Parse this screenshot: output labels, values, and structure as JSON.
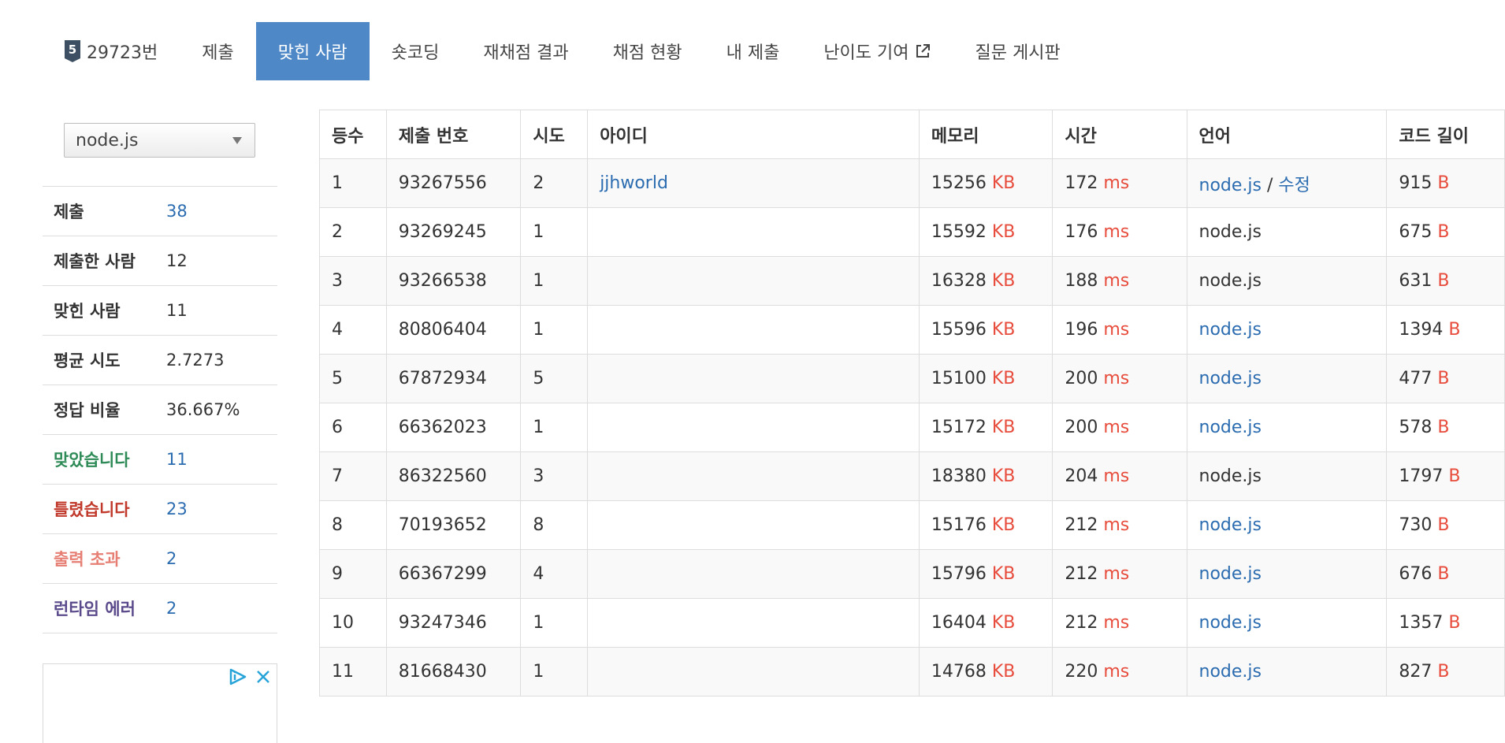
{
  "nav": {
    "problem_label": "29723번",
    "tier_badge_text": "5",
    "items": [
      "제출",
      "맞힌 사람",
      "숏코딩",
      "재채점 결과",
      "채점 현황",
      "내 제출",
      "난이도 기여",
      "질문 게시판"
    ]
  },
  "sidebar": {
    "language_selected": "node.js",
    "stats": [
      {
        "label": "제출",
        "value": "38",
        "label_color": "#333333",
        "value_link": true
      },
      {
        "label": "제출한 사람",
        "value": "12",
        "label_color": "#333333",
        "value_link": false
      },
      {
        "label": "맞힌 사람",
        "value": "11",
        "label_color": "#333333",
        "value_link": false
      },
      {
        "label": "평균 시도",
        "value": "2.7273",
        "label_color": "#333333",
        "value_link": false
      },
      {
        "label": "정답 비율",
        "value": "36.667%",
        "label_color": "#333333",
        "value_link": false
      },
      {
        "label": "맞았습니다",
        "value": "11",
        "label_color": "#2e8b57",
        "value_link": true
      },
      {
        "label": "틀렸습니다",
        "value": "23",
        "label_color": "#c0392b",
        "value_link": true
      },
      {
        "label": "출력 초과",
        "value": "2",
        "label_color": "#e67e73",
        "value_link": true
      },
      {
        "label": "런타임 에러",
        "value": "2",
        "label_color": "#5b4a8b",
        "value_link": true
      }
    ]
  },
  "table": {
    "headers": [
      "등수",
      "제출 번호",
      "시도",
      "아이디",
      "메모리",
      "시간",
      "언어",
      "코드 길이"
    ],
    "units": {
      "memory": "KB",
      "time": "ms",
      "length": "B"
    },
    "edit_label": "수정",
    "rows": [
      {
        "rank": "1",
        "submission": "93267556",
        "attempts": "2",
        "user": "jjhworld",
        "memory": "15256",
        "time": "172",
        "lang": "node.js",
        "lang_link": true,
        "edit": true,
        "length": "915"
      },
      {
        "rank": "2",
        "submission": "93269245",
        "attempts": "1",
        "user": "",
        "memory": "15592",
        "time": "176",
        "lang": "node.js",
        "lang_link": false,
        "edit": false,
        "length": "675"
      },
      {
        "rank": "3",
        "submission": "93266538",
        "attempts": "1",
        "user": "",
        "memory": "16328",
        "time": "188",
        "lang": "node.js",
        "lang_link": false,
        "edit": false,
        "length": "631"
      },
      {
        "rank": "4",
        "submission": "80806404",
        "attempts": "1",
        "user": "",
        "memory": "15596",
        "time": "196",
        "lang": "node.js",
        "lang_link": true,
        "edit": false,
        "length": "1394"
      },
      {
        "rank": "5",
        "submission": "67872934",
        "attempts": "5",
        "user": "",
        "memory": "15100",
        "time": "200",
        "lang": "node.js",
        "lang_link": true,
        "edit": false,
        "length": "477"
      },
      {
        "rank": "6",
        "submission": "66362023",
        "attempts": "1",
        "user": "",
        "memory": "15172",
        "time": "200",
        "lang": "node.js",
        "lang_link": true,
        "edit": false,
        "length": "578"
      },
      {
        "rank": "7",
        "submission": "86322560",
        "attempts": "3",
        "user": "",
        "memory": "18380",
        "time": "204",
        "lang": "node.js",
        "lang_link": false,
        "edit": false,
        "length": "1797"
      },
      {
        "rank": "8",
        "submission": "70193652",
        "attempts": "8",
        "user": "",
        "memory": "15176",
        "time": "212",
        "lang": "node.js",
        "lang_link": true,
        "edit": false,
        "length": "730"
      },
      {
        "rank": "9",
        "submission": "66367299",
        "attempts": "4",
        "user": "",
        "memory": "15796",
        "time": "212",
        "lang": "node.js",
        "lang_link": true,
        "edit": false,
        "length": "676"
      },
      {
        "rank": "10",
        "submission": "93247346",
        "attempts": "1",
        "user": "",
        "memory": "16404",
        "time": "212",
        "lang": "node.js",
        "lang_link": true,
        "edit": false,
        "length": "1357"
      },
      {
        "rank": "11",
        "submission": "81668430",
        "attempts": "1",
        "user": "",
        "memory": "14768",
        "time": "220",
        "lang": "node.js",
        "lang_link": true,
        "edit": false,
        "length": "827"
      }
    ]
  },
  "colors": {
    "accent": "#4e88c7",
    "link": "#2b6cb0",
    "unit": "#e74c3c",
    "badge": "#3d4f63"
  }
}
